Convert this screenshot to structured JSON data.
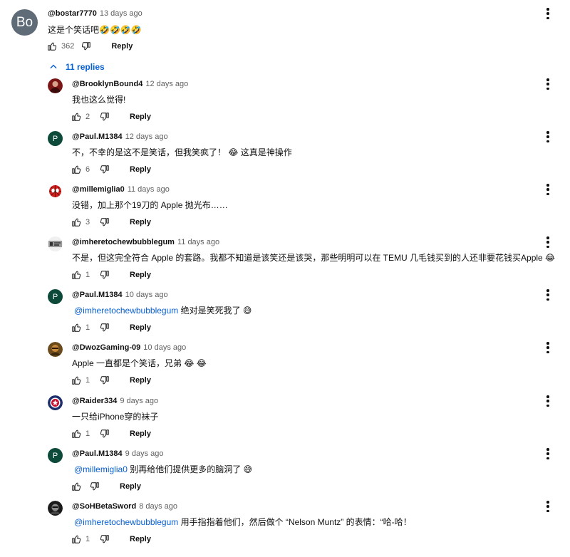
{
  "top_comment": {
    "avatar_initials": "Bo",
    "author": "@bostar7770",
    "time": "13 days ago",
    "text": "这是个笑话吧🤣🤣🤣🤣",
    "likes": "362",
    "reply_label": "Reply"
  },
  "replies_toggle": {
    "label": "11 replies"
  },
  "replies": [
    {
      "author": "@BrooklynBound4",
      "time": "12 days ago",
      "mention": "",
      "text": "我也这么觉得!",
      "likes": "2",
      "reply_label": "Reply"
    },
    {
      "author": "@Paul.M1384",
      "time": "12 days ago",
      "mention": "",
      "text": "不，不幸的是这不是笑话，但我笑疯了！ 😂 这真是神操作",
      "likes": "6",
      "reply_label": "Reply"
    },
    {
      "author": "@millemiglia0",
      "time": "11 days ago",
      "mention": "",
      "text": "没错，加上那个19刀的 Apple 抛光布……",
      "likes": "3",
      "reply_label": "Reply"
    },
    {
      "author": "@imheretochewbubblegum",
      "time": "11 days ago",
      "mention": "",
      "text": "不是，但这完全符合 Apple 的套路。我都不知道是该笑还是该哭，那些明明可以在 TEMU 几毛钱买到的人还非要花钱买Apple 😂",
      "likes": "1",
      "reply_label": "Reply"
    },
    {
      "author": "@Paul.M1384",
      "time": "10 days ago",
      "mention": "@imheretochewbubblegum",
      "text": " 绝对是笑死我了 😅",
      "likes": "1",
      "reply_label": "Reply"
    },
    {
      "author": "@DwozGaming-09",
      "time": "10 days ago",
      "mention": "",
      "text": "Apple 一直都是个笑话，兄弟 😂 😂",
      "likes": "1",
      "reply_label": "Reply"
    },
    {
      "author": "@Raider334",
      "time": "9 days ago",
      "mention": "",
      "text": "一只给iPhone穿的袜子",
      "likes": "1",
      "reply_label": "Reply"
    },
    {
      "author": "@Paul.M1384",
      "time": "9 days ago",
      "mention": "@millemiglia0",
      "text": " 别再给他们提供更多的脑洞了 😅",
      "likes": "",
      "reply_label": "Reply"
    },
    {
      "author": "@SoHBetaSword",
      "time": "8 days ago",
      "mention": "@imheretochewbubblegum",
      "text": " 用手指指着他们，然后做个 “Nelson Muntz” 的表情：“哈-哈！",
      "likes": "1",
      "reply_label": "Reply"
    }
  ],
  "avatars": {
    "paul_letter": "P",
    "paul_color": "#0d4a3a"
  },
  "colors": {
    "link": "#065fd4",
    "meta": "#606060"
  }
}
